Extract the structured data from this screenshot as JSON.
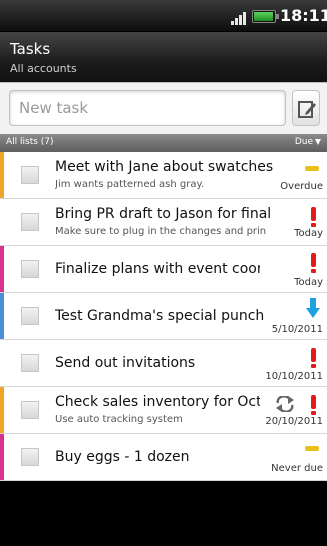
{
  "status_bar": {
    "time": "18:11",
    "signal_icon": "signal-bars-icon",
    "battery_icon": "battery-icon"
  },
  "header": {
    "title": "Tasks",
    "subtitle": "All accounts"
  },
  "new_task": {
    "placeholder": "New task",
    "value": "",
    "edit_icon": "compose-edit-icon"
  },
  "list_header": {
    "left": "All lists (7)",
    "right": "Due"
  },
  "colors": {
    "priority_high": "#e21b1b",
    "priority_normal": "#e8c21a",
    "priority_low": "#1fa0e0",
    "stripe_orange": "#f0a52a",
    "stripe_magenta": "#d6338f",
    "stripe_blue": "#4a8fd6"
  },
  "tasks": [
    {
      "name": "Meet with Jane about swatches f",
      "note": "Jim wants patterned ash gray.",
      "due": "Overdue",
      "priority": "normal",
      "stripe": "orange"
    },
    {
      "name": "Bring PR draft to Jason for final ap",
      "note": "Make sure to plug in the changes and prin",
      "due": "Today",
      "priority": "high",
      "stripe": "none"
    },
    {
      "name": "Finalize plans with event coordina",
      "note": "",
      "due": "Today",
      "priority": "high",
      "stripe": "magenta"
    },
    {
      "name": "Test Grandma's special punch",
      "note": "",
      "due": "5/10/2011",
      "priority": "low",
      "stripe": "blue"
    },
    {
      "name": "Send out invitations",
      "note": "",
      "due": "10/10/2011",
      "priority": "high",
      "stripe": "none"
    },
    {
      "name": "Check sales inventory for Octo",
      "note": "Use auto tracking system",
      "due": "20/10/2011",
      "priority": "high",
      "repeat": true,
      "stripe": "orange"
    },
    {
      "name": "Buy eggs - 1 dozen",
      "note": "",
      "due": "Never due",
      "priority": "normal",
      "stripe": "magenta"
    }
  ]
}
